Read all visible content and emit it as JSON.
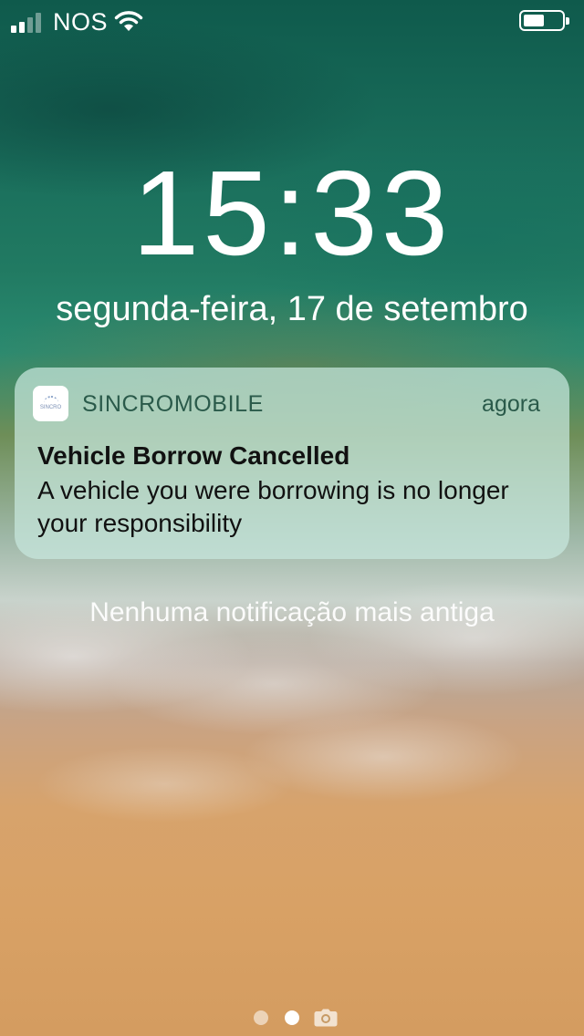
{
  "status_bar": {
    "carrier": "NOS",
    "signal_bars": 2,
    "signal_bars_total": 4,
    "battery_level": 0.55,
    "icons": [
      "signal-bars-icon",
      "wifi-icon",
      "battery-icon"
    ]
  },
  "lock_screen": {
    "time": "15:33",
    "date": "segunda-feira, 17 de setembro"
  },
  "notification": {
    "app_name": "SINCROMOBILE",
    "app_icon": "sincro-app-icon",
    "time": "agora",
    "title": "Vehicle Borrow Cancelled",
    "body": "A vehicle you were borrowing is no longer your responsibility"
  },
  "no_older_text": "Nenhuma notificação mais antiga",
  "page_indicator": {
    "pages": 2,
    "active_index": 1,
    "extra_icon": "camera-icon"
  }
}
